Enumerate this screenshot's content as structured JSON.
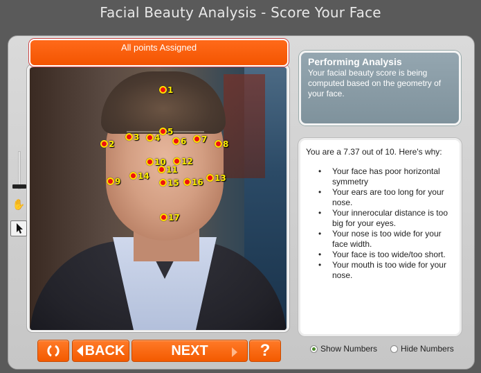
{
  "app": {
    "title": "Facial Beauty Analysis - Score Your Face"
  },
  "status": {
    "text": "All points Assigned"
  },
  "analysis": {
    "heading": "Performing Analysis",
    "body": "Your facial beauty score is being computed based on the geometry of your face."
  },
  "results": {
    "score_line": "You are a 7.37 out of 10.  Here's why:",
    "reasons": [
      "Your face has poor horizontal symmetry",
      "Your ears are too long for your nose.",
      "Your innerocular distance is too big for your eyes.",
      "Your nose is too wide for your face width.",
      "Your face is too wide/too short.",
      "Your mouth is too wide for your nose."
    ]
  },
  "buttons": {
    "back": "BACK",
    "next": "NEXT",
    "help": "?"
  },
  "options": {
    "show_numbers": "Show Numbers",
    "hide_numbers": "Hide Numbers",
    "selected": "show_numbers"
  },
  "landmarks": [
    "1",
    "2",
    "3",
    "4",
    "5",
    "6",
    "7",
    "8",
    "9",
    "10",
    "11",
    "12",
    "13",
    "14",
    "15",
    "16",
    "17"
  ],
  "colors": {
    "accent": "#f35a00",
    "point_fill": "#ee1111",
    "point_ring": "#ffe000",
    "panel": "#7f929c"
  },
  "icons": {
    "reset": "reset-icon",
    "hand": "hand-icon",
    "pointer": "arrow-pointer-icon"
  }
}
